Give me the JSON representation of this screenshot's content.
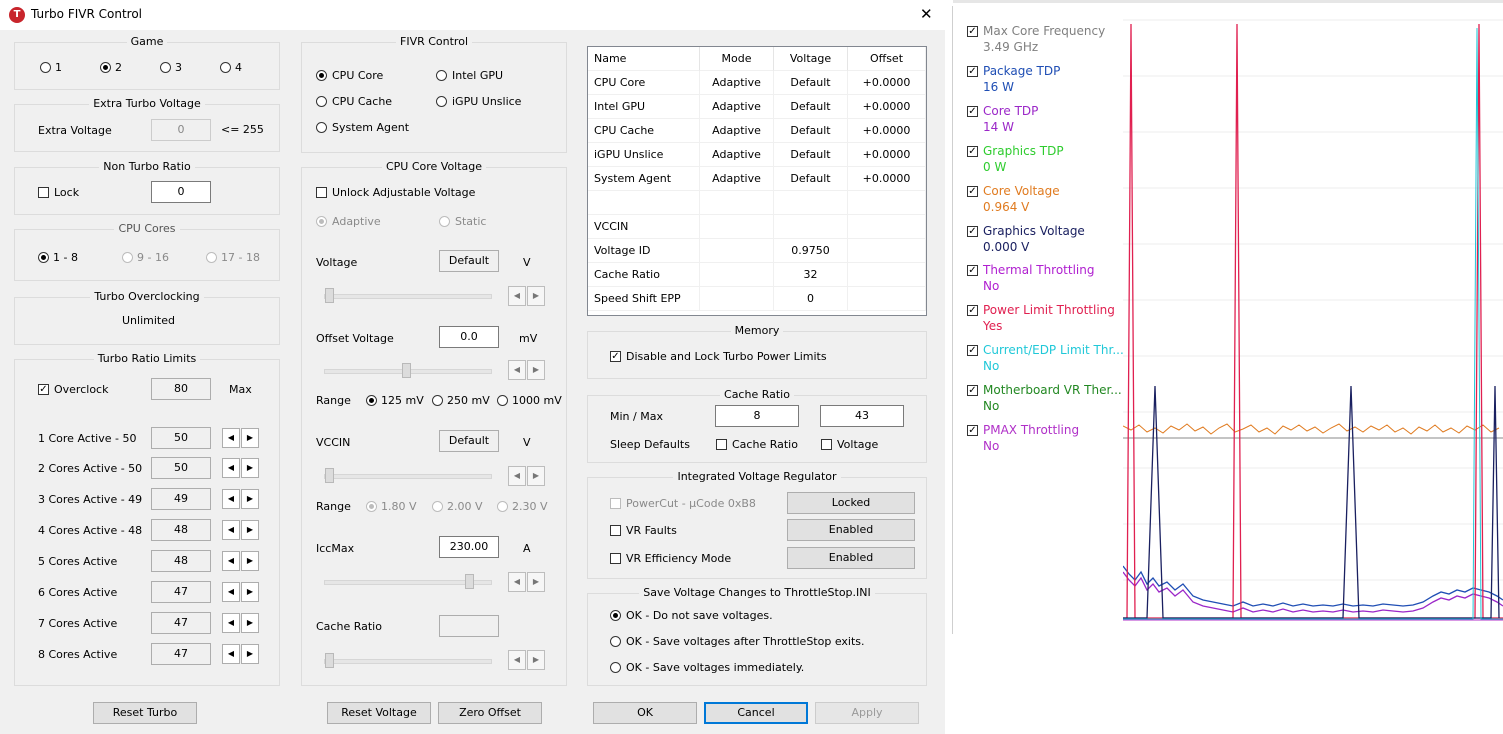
{
  "window": {
    "title": "Turbo FIVR Control",
    "close_glyph": "✕"
  },
  "game": {
    "title": "Game",
    "options": [
      "1",
      "2",
      "3",
      "4"
    ],
    "selected": "2"
  },
  "extra_turbo": {
    "title": "Extra Turbo Voltage",
    "label": "Extra Voltage",
    "value": "0",
    "max_note": "<= 255"
  },
  "non_turbo": {
    "title": "Non Turbo Ratio",
    "lock_label": "Lock",
    "value": "0"
  },
  "cpu_cores": {
    "title": "CPU Cores",
    "options": [
      "1 - 8",
      "9 - 16",
      "17 - 18"
    ],
    "selected": "1 - 8"
  },
  "turbo_oc": {
    "title": "Turbo Overclocking",
    "value": "Unlimited"
  },
  "turbo_ratio": {
    "title": "Turbo Ratio Limits",
    "overclock_label": "Overclock",
    "overclock_value": "80",
    "max_label": "Max",
    "rows": [
      {
        "label": "1 Core  Active - 50",
        "value": "50"
      },
      {
        "label": "2 Cores Active - 50",
        "value": "50"
      },
      {
        "label": "3 Cores Active - 49",
        "value": "49"
      },
      {
        "label": "4 Cores Active - 48",
        "value": "48"
      },
      {
        "label": "5 Cores Active",
        "value": "48"
      },
      {
        "label": "6 Cores Active",
        "value": "47"
      },
      {
        "label": "7 Cores Active",
        "value": "47"
      },
      {
        "label": "8 Cores Active",
        "value": "47"
      }
    ],
    "reset_label": "Reset Turbo"
  },
  "fivr": {
    "title": "FIVR Control",
    "options": [
      "CPU Core",
      "Intel GPU",
      "CPU Cache",
      "iGPU Unslice",
      "System Agent"
    ],
    "selected": "CPU Core"
  },
  "core_voltage": {
    "title": "CPU Core Voltage",
    "unlock_label": "Unlock Adjustable Voltage",
    "adaptive_label": "Adaptive",
    "static_label": "Static",
    "voltage_label": "Voltage",
    "voltage_value": "Default",
    "voltage_unit": "V",
    "offset_label": "Offset Voltage",
    "offset_value": "0.0",
    "offset_unit": "mV",
    "range_label": "Range",
    "range_options": [
      "125 mV",
      "250 mV",
      "1000 mV"
    ],
    "range_selected": "125 mV",
    "vccin_label": "VCCIN",
    "vccin_value": "Default",
    "vccin_unit": "V",
    "vccin_range_label": "Range",
    "vccin_range_options": [
      "1.80 V",
      "2.00 V",
      "2.30 V"
    ],
    "iccmax_label": "IccMax",
    "iccmax_value": "230.00",
    "iccmax_unit": "A",
    "cache_ratio_label": "Cache Ratio",
    "cache_ratio_value": "",
    "reset_label": "Reset Voltage",
    "zero_label": "Zero Offset"
  },
  "voltage_table": {
    "headers": [
      "Name",
      "Mode",
      "Voltage",
      "Offset"
    ],
    "rows": [
      [
        "CPU Core",
        "Adaptive",
        "Default",
        "+0.0000"
      ],
      [
        "Intel GPU",
        "Adaptive",
        "Default",
        "+0.0000"
      ],
      [
        "CPU Cache",
        "Adaptive",
        "Default",
        "+0.0000"
      ],
      [
        "iGPU Unslice",
        "Adaptive",
        "Default",
        "+0.0000"
      ],
      [
        "System Agent",
        "Adaptive",
        "Default",
        "+0.0000"
      ],
      [
        "",
        "",
        "",
        ""
      ],
      [
        "VCCIN",
        "",
        "",
        ""
      ],
      [
        "Voltage ID",
        "",
        "0.9750",
        ""
      ],
      [
        "Cache Ratio",
        "",
        "32",
        ""
      ],
      [
        "Speed Shift EPP",
        "",
        "0",
        ""
      ]
    ]
  },
  "memory": {
    "title": "Memory",
    "label": "Disable and Lock Turbo Power Limits"
  },
  "cache_ratio": {
    "title": "Cache Ratio",
    "minmax_label": "Min / Max",
    "min": "8",
    "max": "43",
    "sleep_label": "Sleep Defaults",
    "cache_chk": "Cache Ratio",
    "voltage_chk": "Voltage"
  },
  "ivr": {
    "title": "Integrated Voltage Regulator",
    "powercut_label": "PowerCut  -  µCode 0xB8",
    "powercut_btn": "Locked",
    "vrfaults_label": "VR Faults",
    "vrfaults_btn": "Enabled",
    "vreff_label": "VR Efficiency Mode",
    "vreff_btn": "Enabled"
  },
  "save": {
    "title": "Save Voltage Changes to ThrottleStop.INI",
    "options": [
      "OK - Do not save voltages.",
      "OK - Save voltages after ThrottleStop exits.",
      "OK - Save voltages immediately."
    ],
    "selected": 0
  },
  "buttons": {
    "ok": "OK",
    "cancel": "Cancel",
    "apply": "Apply"
  },
  "stats": [
    {
      "name": "Max Core Frequency",
      "value": "3.49 GHz",
      "color": "#7f7f7f"
    },
    {
      "name": "Package TDP",
      "value": "16 W",
      "color": "#1f4eb4"
    },
    {
      "name": "Core TDP",
      "value": "14 W",
      "color": "#9b27c8"
    },
    {
      "name": "Graphics TDP",
      "value": "0 W",
      "color": "#2ecc2e"
    },
    {
      "name": "Core Voltage",
      "value": "0.964 V",
      "color": "#e07b20"
    },
    {
      "name": "Graphics Voltage",
      "value": "0.000 V",
      "color": "#1a2060"
    },
    {
      "name": "Thermal Throttling",
      "value": "No",
      "color": "#b020d0"
    },
    {
      "name": "Power Limit Throttling",
      "value": "Yes",
      "color": "#e02050"
    },
    {
      "name": "Current/EDP Limit Thr...",
      "value": "No",
      "color": "#20c8d8"
    },
    {
      "name": "Motherboard VR Ther...",
      "value": "No",
      "color": "#228822"
    },
    {
      "name": "PMAX Throttling",
      "value": "No",
      "color": "#b030c8"
    }
  ]
}
